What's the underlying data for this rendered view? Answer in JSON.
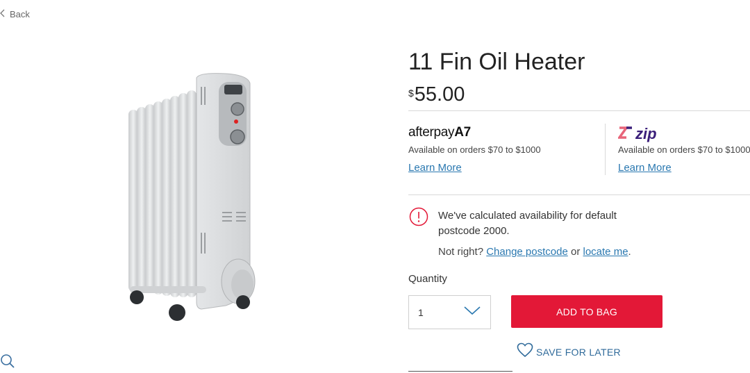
{
  "nav": {
    "back_label": "Back"
  },
  "product": {
    "title": "11 Fin Oil Heater",
    "price_currency": "$",
    "price_amount": "55.00"
  },
  "afterpay": {
    "brand_light": "afterpay",
    "brand_mark": "A7",
    "availability": "Available on orders $70 to $1000",
    "learn_more": "Learn More"
  },
  "zip": {
    "brand": "zip",
    "availability": "Available on orders $70 to $1000",
    "learn_more": "Learn More"
  },
  "stock_alert": {
    "message": "We've calculated availability for default postcode 2000.",
    "prompt": "Not right?",
    "change_postcode": "Change postcode",
    "or": "or",
    "locate_me": "locate me",
    "period": "."
  },
  "purchase": {
    "quantity_label": "Quantity",
    "quantity_value": "1",
    "add_to_bag": "ADD TO BAG",
    "save_for_later": "SAVE FOR LATER"
  },
  "colors": {
    "accent_red": "#e31837",
    "link_blue": "#2a78b0",
    "zip_purple": "#3b1f7a"
  },
  "icons": [
    "chevron-left-icon",
    "search-icon",
    "alert-circle-icon",
    "chevron-down-icon",
    "heart-icon"
  ]
}
